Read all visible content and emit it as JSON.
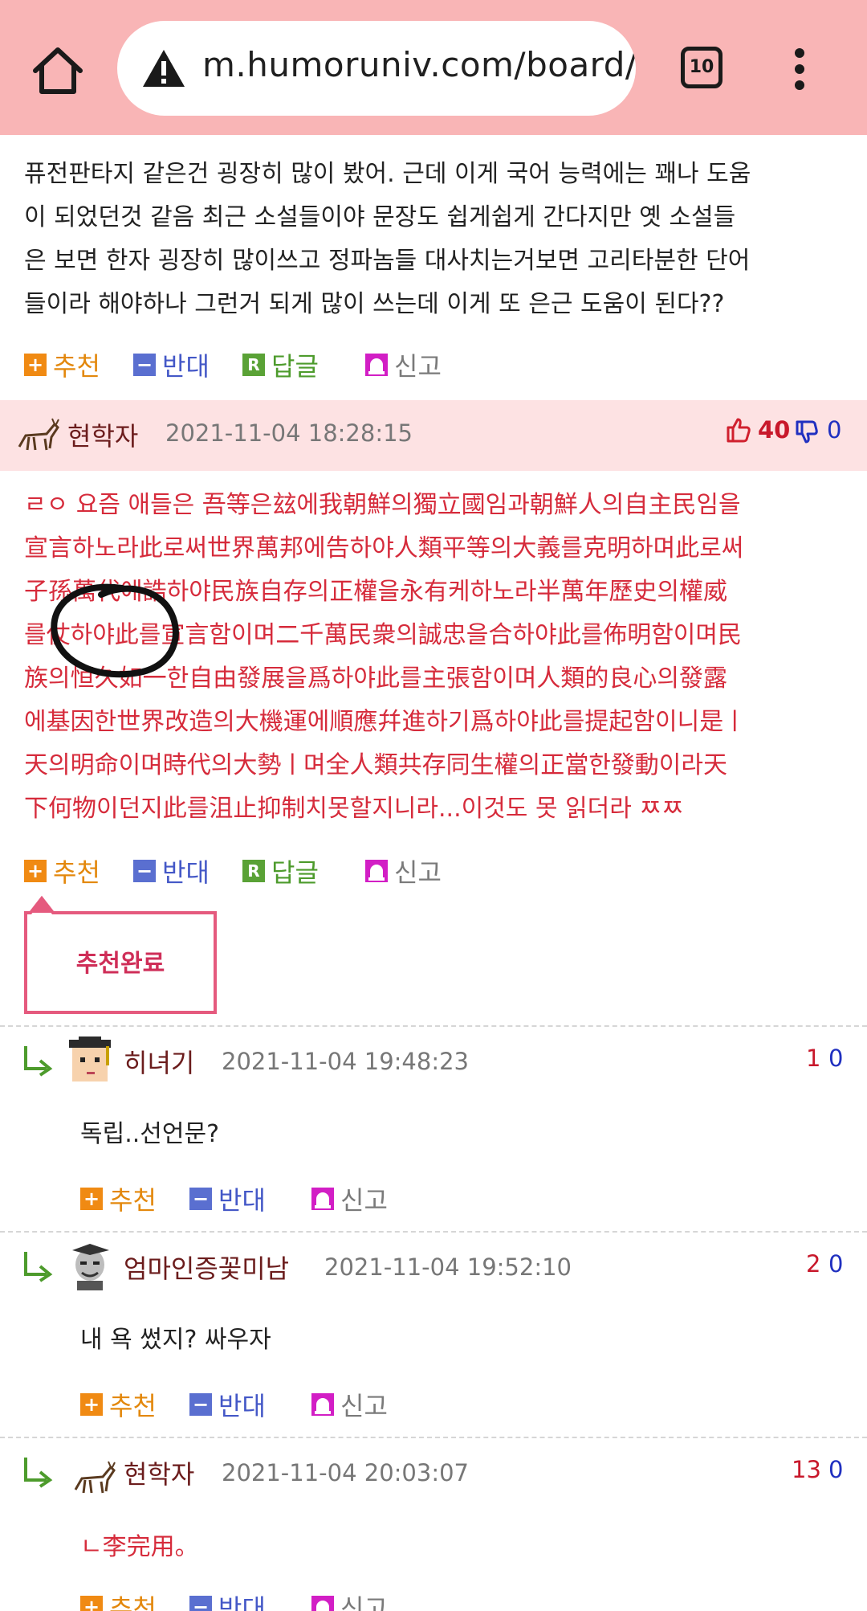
{
  "browser": {
    "url": "m.humoruniv.com/board/",
    "tab_count": "10"
  },
  "post_partial": {
    "lines": [
      "퓨전판타지 같은건 굉장히 많이 봤어. 근데 이게 국어 능력에는 꽤나 도움",
      "이 되었던것 같음 최근 소설들이야 문장도 쉽게쉽게 간다지만 옛 소설들",
      "은 보면 한자 굉장히 많이쓰고 정파놈들 대사치는거보면 고리타분한 단어",
      "들이라 해야하나 그런거 되게 많이 쓰는데 이게 또 은근 도움이 된다??"
    ]
  },
  "actions": {
    "recommend": "추천",
    "oppose": "반대",
    "reply": "답글",
    "report": "신고",
    "reply_icon": "R"
  },
  "comment_main": {
    "nickname": "현학자",
    "date": "2021-11-04 18:28:15",
    "likes": "40",
    "dislikes": "0",
    "lines": [
      "ㄹㅇ 요즘 애들은 吾等은玆에我朝鮮의獨立國임과朝鮮人의自主民임을",
      "宣言하노라此로써世界萬邦에告하야人類平等의大義를克明하며此로써",
      "子孫萬代에誥하야民族自存의正權을永有케하노라半萬年歷史의權威",
      "를仗하야此를宣言함이며二千萬民衆의誠忠을合하야此를佈明함이며民",
      "族의恒久如一한自由發展을爲하야此를主張함이며人類的良心의發露",
      "에基因한世界改造의大機運에順應幷進하기爲하야此를提起함이니是ㅣ",
      "天의明命이며時代의大勢ㅣ며全人類共存同生權의正當한發動이라天",
      "下何物이던지此를沮止抑制치못할지니라...이것도 못 읽더라 ㅉㅉ"
    ],
    "tooltip": "추천완료"
  },
  "replies": [
    {
      "nickname": "히녀기",
      "date": "2021-11-04 19:48:23",
      "likes": "1",
      "dislikes": "0",
      "text": "독립..선언문?"
    },
    {
      "nickname": "엄마인증꽃미남",
      "date": "2021-11-04 19:52:10",
      "likes": "2",
      "dislikes": "0",
      "text": "내 욕 썼지? 싸우자"
    },
    {
      "nickname": "현학자",
      "date": "2021-11-04 20:03:07",
      "likes": "13",
      "dislikes": "0",
      "text": "ㄴ李完用。"
    }
  ],
  "colors": {
    "browser_bar": "#f9b5b6",
    "comment_header": "#fde2e3",
    "red_text": "#d62b3b",
    "recommend": "#e3880d",
    "oppose": "#4458c7",
    "reply": "#4d9b2c"
  },
  "icons": [
    "home-icon",
    "warning-icon",
    "tabs-icon",
    "more-vert-icon",
    "deer-avatar-icon",
    "thumbs-up-icon",
    "thumbs-down-icon",
    "reply-arrow-icon",
    "siren-icon"
  ]
}
